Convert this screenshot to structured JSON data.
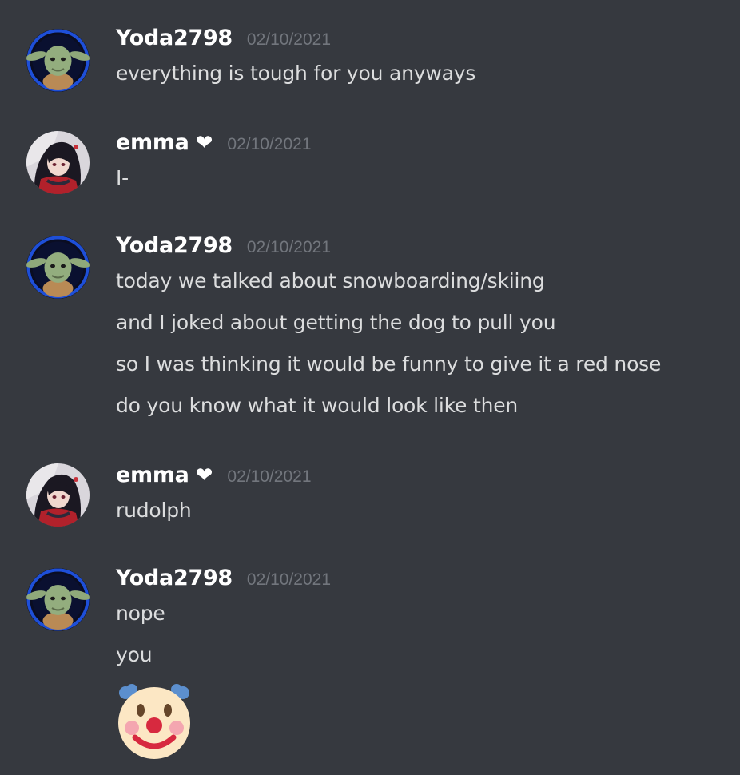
{
  "messages": [
    {
      "author": "Yoda2798",
      "avatar": "yoda-avatar",
      "timestamp": "02/10/2021",
      "lines": [
        "everything is tough for you anyways"
      ]
    },
    {
      "author": "emma",
      "author_badge": "heart-icon",
      "avatar": "anime-girl-avatar",
      "timestamp": "02/10/2021",
      "lines": [
        "I-"
      ]
    },
    {
      "author": "Yoda2798",
      "avatar": "yoda-avatar",
      "timestamp": "02/10/2021",
      "lines": [
        "today we talked about snowboarding/skiing",
        "and I joked about getting the dog to pull you",
        "so I was thinking it would be funny to give it a red nose",
        "do you know what it would look like then"
      ]
    },
    {
      "author": "emma",
      "author_badge": "heart-icon",
      "avatar": "anime-girl-avatar",
      "timestamp": "02/10/2021",
      "lines": [
        "rudolph"
      ]
    },
    {
      "author": "Yoda2798",
      "avatar": "yoda-avatar",
      "timestamp": "02/10/2021",
      "lines": [
        "nope",
        "you"
      ],
      "emoji": "clown-face-emoji"
    }
  ],
  "theme": {
    "background": "#36393f",
    "username_color": "#ffffff",
    "text_color": "#dcddde",
    "timestamp_color": "#72767d",
    "avatar_ring_blue": "#1e4fd8"
  }
}
